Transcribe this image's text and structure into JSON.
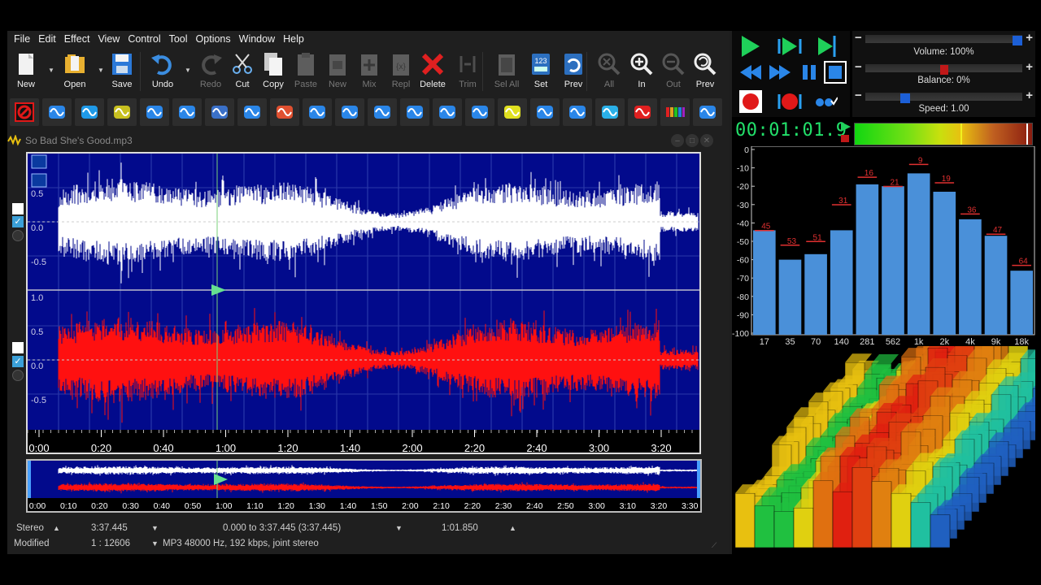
{
  "menu": [
    "File",
    "Edit",
    "Effect",
    "View",
    "Control",
    "Tool",
    "Options",
    "Window",
    "Help"
  ],
  "toolbar": {
    "buttons": [
      {
        "label": "New",
        "icon": "new-file-icon",
        "enabled": true
      },
      {
        "label": "Open",
        "icon": "open-folder-icon",
        "enabled": true
      },
      {
        "label": "Save",
        "icon": "save-disk-icon",
        "enabled": true
      },
      {
        "label": "Undo",
        "icon": "undo-icon",
        "enabled": true
      },
      {
        "label": "Redo",
        "icon": "redo-icon",
        "enabled": false
      },
      {
        "label": "Cut",
        "icon": "scissors-icon",
        "enabled": true
      },
      {
        "label": "Copy",
        "icon": "copy-icon",
        "enabled": true
      },
      {
        "label": "Paste",
        "icon": "paste-icon",
        "enabled": false
      },
      {
        "label": "New",
        "icon": "paste-new-icon",
        "enabled": false
      },
      {
        "label": "Mix",
        "icon": "mix-icon",
        "enabled": false
      },
      {
        "label": "Repl",
        "icon": "replace-icon",
        "enabled": false
      },
      {
        "label": "Delete",
        "icon": "delete-x-icon",
        "enabled": true
      },
      {
        "label": "Trim",
        "icon": "trim-icon",
        "enabled": false
      },
      {
        "label": "Sel All",
        "icon": "select-all-icon",
        "enabled": false
      },
      {
        "label": "Set",
        "icon": "set-selection-icon",
        "enabled": true
      },
      {
        "label": "Prev",
        "icon": "previous-selection-icon",
        "enabled": true
      },
      {
        "label": "All",
        "icon": "zoom-all-icon",
        "enabled": false
      },
      {
        "label": "In",
        "icon": "zoom-in-icon",
        "enabled": true
      },
      {
        "label": "Out",
        "icon": "zoom-out-icon",
        "enabled": false
      },
      {
        "label": "Prev",
        "icon": "zoom-previous-icon",
        "enabled": true
      }
    ]
  },
  "effects_toolbar": [
    "mute-icon",
    "fade-icon",
    "normalize-icon",
    "amplify-icon",
    "echo-icon",
    "wave-shape-icon",
    "reverse-icon",
    "compressor-icon",
    "color-filter-icon",
    "expander-icon",
    "pitch-icon",
    "stretch-icon",
    "backward-icon",
    "equalizer-icon",
    "noise-icon",
    "eq-bars-icon",
    "band-icon",
    "spectrum-icon",
    "burst-icon",
    "flanger-icon",
    "rainbow-icon",
    "speaker-icon"
  ],
  "document": {
    "title": "So Bad She's Good.mp3",
    "amplitude_labels": [
      "0.5",
      "0.0",
      "-0.5",
      "1.0",
      "0.5",
      "0.0",
      "-0.5"
    ],
    "timeline": [
      "0:00",
      "0:20",
      "0:40",
      "1:00",
      "1:20",
      "1:40",
      "2:00",
      "2:20",
      "2:40",
      "3:00",
      "3:20"
    ],
    "overview_timeline": [
      "0:00",
      "0:10",
      "0:20",
      "0:30",
      "0:40",
      "0:50",
      "1:00",
      "1:10",
      "1:20",
      "1:30",
      "1:40",
      "1:50",
      "2:00",
      "2:10",
      "2:20",
      "2:30",
      "2:40",
      "2:50",
      "3:00",
      "3:10",
      "3:20",
      "3:30"
    ],
    "colors": {
      "background": "#020a8c",
      "left_channel": "#ffffff",
      "right_channel": "#ff1010"
    }
  },
  "status": {
    "channels": "Stereo",
    "length": "3:37.445",
    "selection": "0.000 to 3:37.445 (3:37.445)",
    "cursor": "1:01.850",
    "state": "Modified",
    "zoom": "1 : 12606",
    "format": "MP3 48000 Hz, 192 kbps, joint stereo"
  },
  "transport": {
    "icons": [
      "play-icon",
      "play-loop-icon",
      "play-to-end-icon",
      "rewind-icon",
      "fast-forward-icon",
      "pause-icon",
      "stop-icon",
      "record-icon",
      "record-loop-icon",
      "record-options-icon"
    ]
  },
  "sliders": {
    "volume": {
      "label": "Volume: 100%",
      "value": 1.0
    },
    "balance": {
      "label": "Balance: 0%",
      "value": 0.0
    },
    "speed": {
      "label": "Speed: 1.00",
      "value": 1.0
    }
  },
  "time_display": "00:01:01.9",
  "spectrum": {
    "y_ticks": [
      "0",
      "-10",
      "-20",
      "-30",
      "-40",
      "-50",
      "-60",
      "-70",
      "-80",
      "-90",
      "-100"
    ],
    "bands": [
      "17",
      "35",
      "70",
      "140",
      "281",
      "562",
      "1k",
      "2k",
      "4k",
      "9k",
      "18k"
    ],
    "peak_labels": [
      "45",
      "53",
      "51",
      "31",
      "16",
      "21",
      "9",
      "19",
      "36",
      "47",
      "64"
    ],
    "levels_db": [
      -44,
      -60,
      -57,
      -44,
      -19,
      -20,
      -13,
      -23,
      -38,
      -47,
      -66
    ],
    "colors": {
      "bar": "#4a90d9",
      "peak": "#e03030"
    }
  }
}
